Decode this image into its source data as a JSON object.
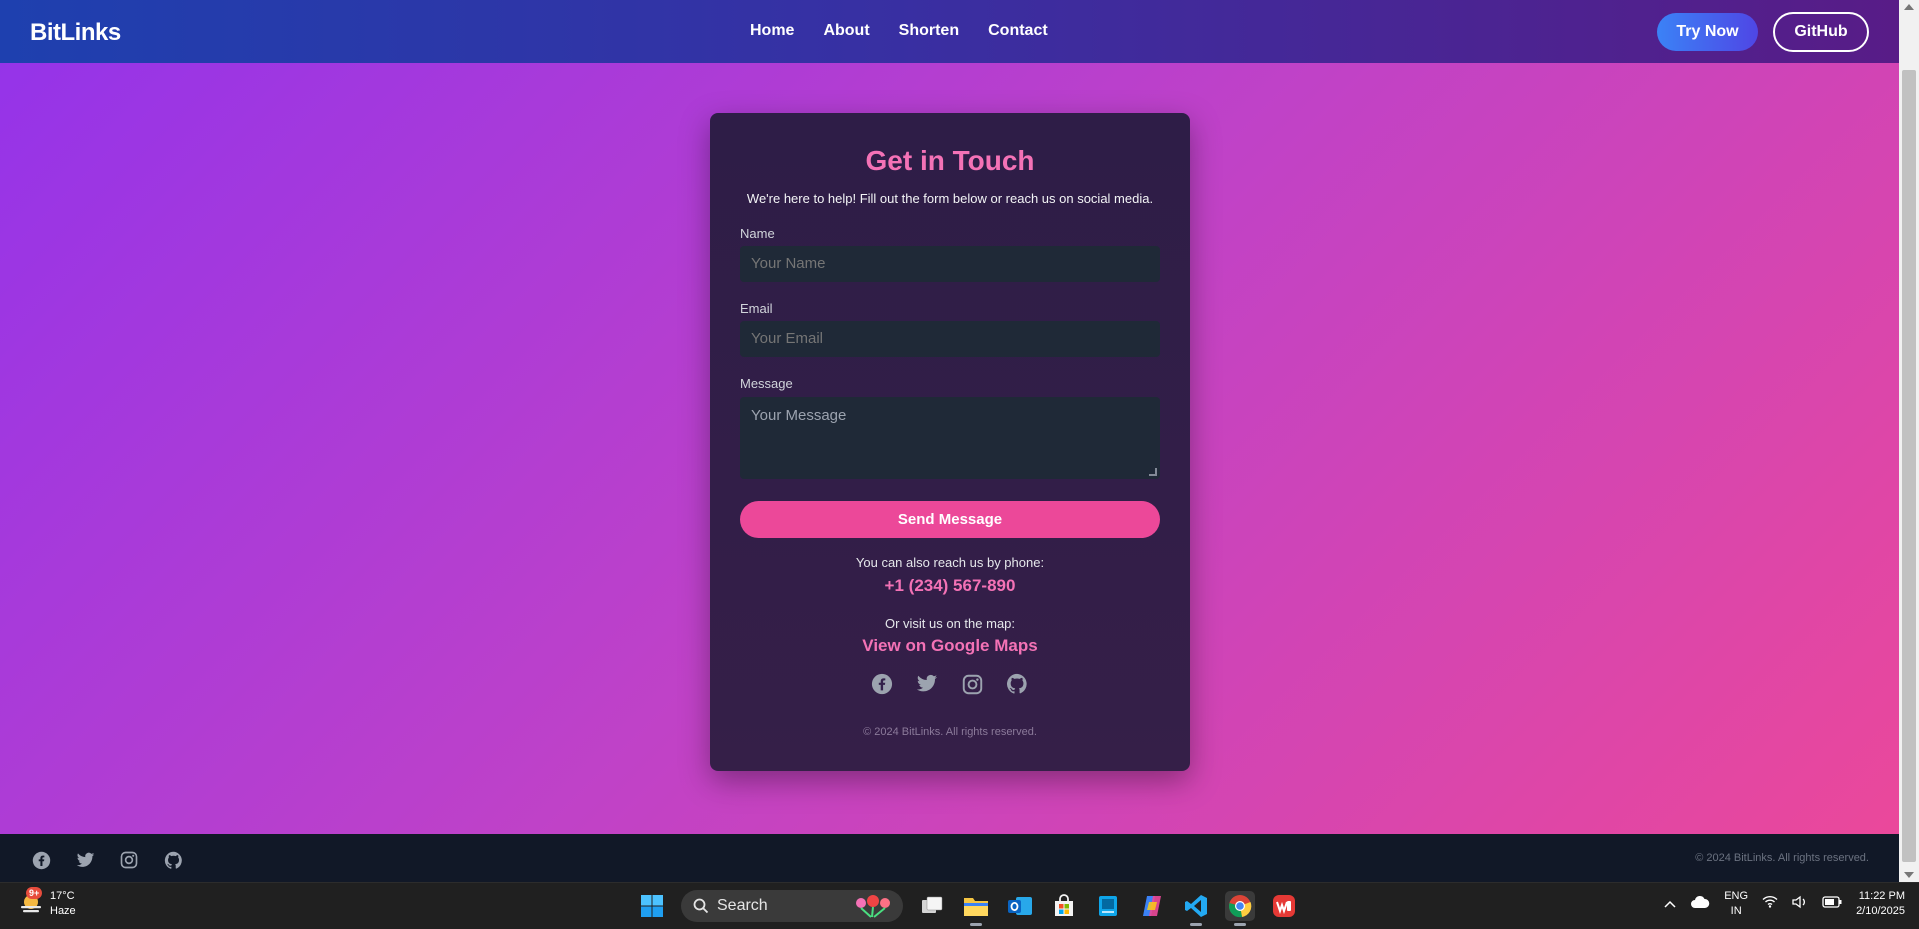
{
  "navbar": {
    "brand": "BitLinks",
    "links": [
      "Home",
      "About",
      "Shorten",
      "Contact"
    ],
    "try_now": "Try Now",
    "github": "GitHub"
  },
  "contact": {
    "title": "Get in Touch",
    "subtitle": "We're here to help! Fill out the form below or reach us on social media.",
    "name_label": "Name",
    "name_placeholder": "Your Name",
    "email_label": "Email",
    "email_placeholder": "Your Email",
    "message_label": "Message",
    "message_placeholder": "Your Message",
    "send_button": "Send Message",
    "phone_intro": "You can also reach us by phone:",
    "phone": "+1 (234) 567-890",
    "map_intro": "Or visit us on the map:",
    "map_link": "View on Google Maps",
    "socials": [
      "facebook-icon",
      "twitter-icon",
      "instagram-icon",
      "github-icon"
    ],
    "copyright": "© 2024 BitLinks. All rights reserved."
  },
  "footer": {
    "socials": [
      "facebook-icon",
      "twitter-icon",
      "instagram-icon",
      "github-icon"
    ],
    "copyright": "© 2024 BitLinks. All rights reserved."
  },
  "taskbar": {
    "weather_temp": "17°C",
    "weather_desc": "Haze",
    "weather_badge": "9+",
    "search_label": "Search",
    "lang_line1": "ENG",
    "lang_line2": "IN",
    "time": "11:22 PM",
    "date": "2/10/2025"
  },
  "colors": {
    "accent_pink": "#f472b6",
    "button_pink": "#ec4899",
    "card_bg": "#2e1d47",
    "nav_start": "#1e40af",
    "nav_end": "#581c87"
  }
}
